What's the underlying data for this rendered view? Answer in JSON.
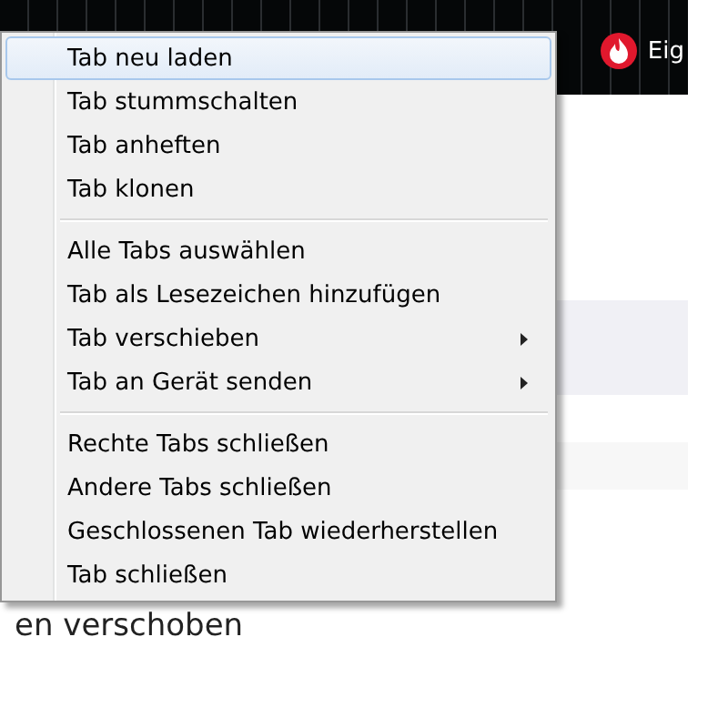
{
  "top_bar": {
    "title": "Eig"
  },
  "background_text": "en verschoben",
  "context_menu": {
    "groups": [
      [
        {
          "label": "Tab neu laden",
          "selected": true,
          "submenu": false
        },
        {
          "label": "Tab stummschalten",
          "selected": false,
          "submenu": false
        },
        {
          "label": "Tab anheften",
          "selected": false,
          "submenu": false
        },
        {
          "label": "Tab klonen",
          "selected": false,
          "submenu": false
        }
      ],
      [
        {
          "label": "Alle Tabs auswählen",
          "selected": false,
          "submenu": false
        },
        {
          "label": "Tab als Lesezeichen hinzufügen",
          "selected": false,
          "submenu": false
        },
        {
          "label": "Tab verschieben",
          "selected": false,
          "submenu": true
        },
        {
          "label": "Tab an Gerät senden",
          "selected": false,
          "submenu": true
        }
      ],
      [
        {
          "label": "Rechte Tabs schließen",
          "selected": false,
          "submenu": false
        },
        {
          "label": "Andere Tabs schließen",
          "selected": false,
          "submenu": false
        },
        {
          "label": "Geschlossenen Tab wiederherstellen",
          "selected": false,
          "submenu": false
        },
        {
          "label": "Tab schließen",
          "selected": false,
          "submenu": false
        }
      ]
    ]
  }
}
